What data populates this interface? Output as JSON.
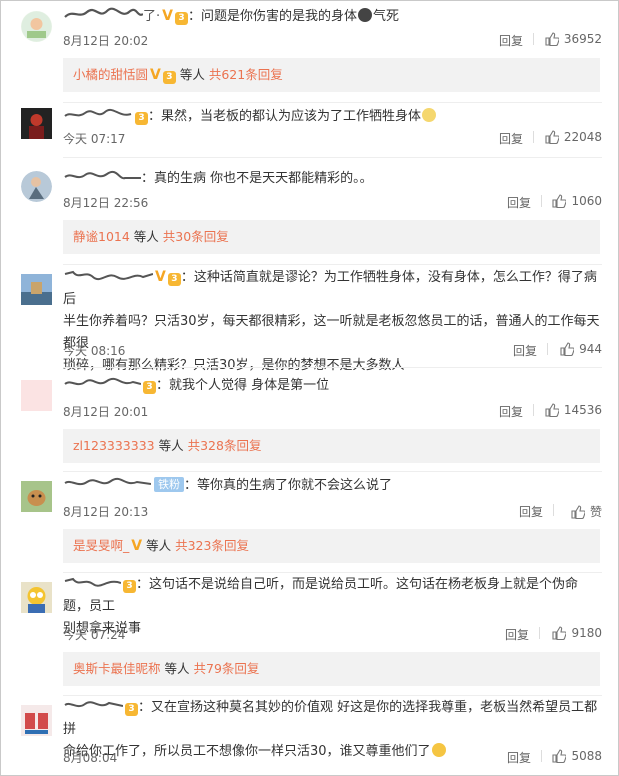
{
  "comments": [
    {
      "name_suffix": "了·",
      "text": "：问题是你伤害的是我的身体",
      "text_after": "气死",
      "time": "8月12日 20:02",
      "reply": "回复",
      "likes": "36952",
      "sub": {
        "user": "小橘的甜恬圆",
        "mid": "等人",
        "count": "共621条回复"
      }
    },
    {
      "text": "：果然，当老板的都认为应该为了工作牺牲身体",
      "time": "今天 07:17",
      "reply": "回复",
      "likes": "22048"
    },
    {
      "text": "：真的生病 你也不是天天都能精彩的。。",
      "time": "8月12日 22:56",
      "reply": "回复",
      "likes": "1060",
      "sub": {
        "user": "静谧1014",
        "mid": "等人",
        "count": "共30条回复"
      }
    },
    {
      "text_line1": "：这种话简直就是谬论？为工作牺牲身体，没有身体，怎么工作？得了病后",
      "text_line2": "半生你养着吗？只活30岁，每天都很精彩，这一听就是老板忽悠员工的话，普通人的工作每天都很",
      "text_line3": "琐碎，哪有那么精彩？只活30岁，是你的梦想不是大多数人",
      "time": "今天 08:16",
      "reply": "回复",
      "likes": "944"
    },
    {
      "text": "：就我个人觉得 身体是第一位",
      "time": "8月12日 20:01",
      "reply": "回复",
      "likes": "14536",
      "sub": {
        "user": "zl123333333",
        "mid": "等人",
        "count": "共328条回复"
      }
    },
    {
      "badge": "铁粉",
      "text": "：等你真的生病了你就不会这么说了",
      "time": "8月12日 20:13",
      "reply": "回复",
      "likes": "赞",
      "sub": {
        "user": "是旻旻啊_",
        "mid": "等人",
        "count": "共323条回复"
      }
    },
    {
      "text_line1": "：这句话不是说给自己听，而是说给员工听。这句话在杨老板身上就是个伪命题，员工",
      "text_line2": "别想拿来说事",
      "time": "今天 07:24",
      "reply": "回复",
      "likes": "9180",
      "sub": {
        "user": "奥斯卡最佳昵称",
        "mid": "等人",
        "count": "共79条回复"
      }
    },
    {
      "text_line1": "：又在宣扬这种莫名其妙的价值观 好这是你的选择我尊重，老板当然希望员工都拼",
      "text_line2": "命给你工作了，所以员工不想像你一样只活30，谁又尊重他们了",
      "time": "8月08:04",
      "reply": "回复",
      "likes": "5088"
    }
  ],
  "colors": {
    "link": "#eb7350",
    "subbox_bg": "#f2f2f2",
    "verified": "#f5a623",
    "fan_badge": "#9ec8ee"
  },
  "icons": {
    "like": "thumbs-up-icon",
    "verified": "v-badge-icon",
    "rank": "rank-badge-icon"
  }
}
